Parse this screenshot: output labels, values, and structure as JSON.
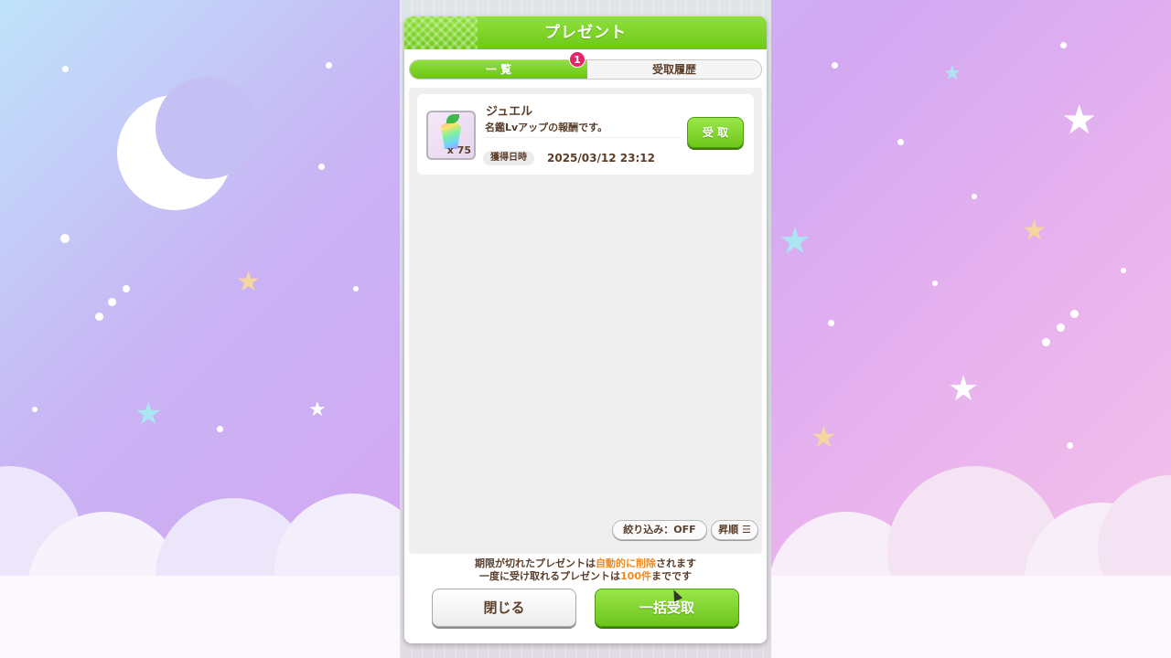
{
  "dialog": {
    "title": "プレゼント"
  },
  "tabs": [
    {
      "label": "一 覧",
      "active": true
    },
    {
      "label": "受取履歴",
      "active": false
    }
  ],
  "tab_badge": "1",
  "items": [
    {
      "name": "ジュエル",
      "icon": "jewel-icon",
      "quantity": "x 75",
      "description": "名鑑Lvアップの報酬です。",
      "date_label": "獲得日時",
      "date": "2025/03/12 23:12",
      "action_label": "受 取"
    }
  ],
  "controls": {
    "filter_label": "絞り込み：OFF",
    "sort_label": "昇順 ☰"
  },
  "notes": {
    "line1_a": "期限が切れたプレゼントは",
    "line1_hl": "自動的に削除",
    "line1_b": "されます",
    "line2_a": "一度に受け取れるプレゼントは",
    "line2_hl": "100件",
    "line2_b": "までです"
  },
  "footer": {
    "close_label": "閉じる",
    "bulk_label": "一括受取"
  },
  "colors": {
    "accent_green": "#6fc81a",
    "text_brown": "#5b3e2a",
    "badge_pink": "#e8236b",
    "highlight_orange": "#f08a1c"
  }
}
